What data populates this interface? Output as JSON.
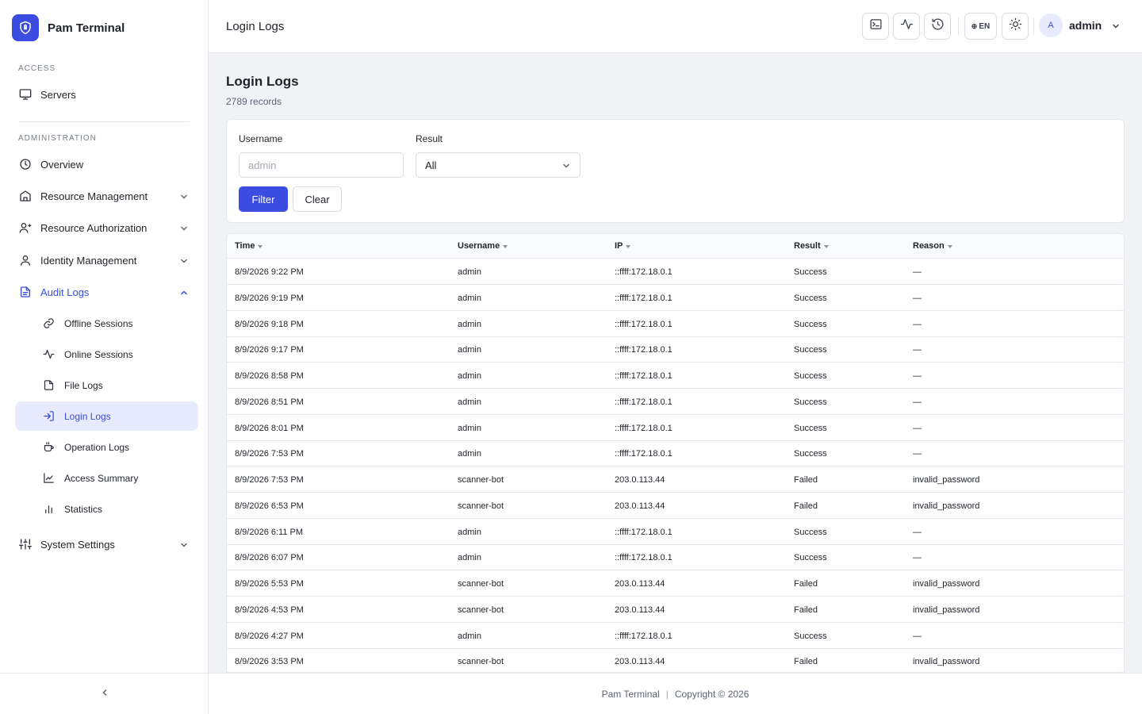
{
  "app": {
    "name": "Pam Terminal"
  },
  "sidebar": {
    "sections": [
      {
        "label": "ACCESS"
      },
      {
        "label": "ADMINISTRATION"
      }
    ],
    "access_items": [
      {
        "label": "Servers",
        "icon": "monitor-icon"
      }
    ],
    "admin_items": [
      {
        "label": "Overview",
        "icon": "clock-icon"
      },
      {
        "label": "Resource Management",
        "icon": "building-icon"
      },
      {
        "label": "Resource Authorization",
        "icon": "user-key-icon"
      },
      {
        "label": "Identity Management",
        "icon": "user-icon"
      },
      {
        "label": "Audit Logs",
        "icon": "file-text-icon",
        "expanded": true
      },
      {
        "label": "System Settings",
        "icon": "sliders-icon"
      }
    ],
    "audit_subitems": [
      {
        "label": "Offline Sessions",
        "icon": "link-icon"
      },
      {
        "label": "Online Sessions",
        "icon": "activity-icon"
      },
      {
        "label": "File Logs",
        "icon": "file-icon"
      },
      {
        "label": "Login Logs",
        "icon": "login-icon",
        "active": true
      },
      {
        "label": "Operation Logs",
        "icon": "coffee-icon"
      },
      {
        "label": "Access Summary",
        "icon": "line-chart-icon"
      },
      {
        "label": "Statistics",
        "icon": "bar-chart-icon"
      }
    ]
  },
  "header": {
    "title": "Login Logs",
    "lang": "EN",
    "user": {
      "initial": "A",
      "name": "admin"
    }
  },
  "page": {
    "title": "Login Logs",
    "count_text": "2789 records"
  },
  "filters": {
    "username_label": "Username",
    "username_placeholder": "admin",
    "result_label": "Result",
    "result_value": "All",
    "filter_button": "Filter",
    "clear_button": "Clear"
  },
  "table": {
    "columns": [
      "Time",
      "Username",
      "IP",
      "Result",
      "Reason"
    ],
    "rows": [
      [
        "8/9/2026 9:22 PM",
        "admin",
        "::ffff:172.18.0.1",
        "Success",
        "—"
      ],
      [
        "8/9/2026 9:19 PM",
        "admin",
        "::ffff:172.18.0.1",
        "Success",
        "—"
      ],
      [
        "8/9/2026 9:18 PM",
        "admin",
        "::ffff:172.18.0.1",
        "Success",
        "—"
      ],
      [
        "8/9/2026 9:17 PM",
        "admin",
        "::ffff:172.18.0.1",
        "Success",
        "—"
      ],
      [
        "8/9/2026 8:58 PM",
        "admin",
        "::ffff:172.18.0.1",
        "Success",
        "—"
      ],
      [
        "8/9/2026 8:51 PM",
        "admin",
        "::ffff:172.18.0.1",
        "Success",
        "—"
      ],
      [
        "8/9/2026 8:01 PM",
        "admin",
        "::ffff:172.18.0.1",
        "Success",
        "—"
      ],
      [
        "8/9/2026 7:53 PM",
        "admin",
        "::ffff:172.18.0.1",
        "Success",
        "—"
      ],
      [
        "8/9/2026 7:53 PM",
        "scanner-bot",
        "203.0.113.44",
        "Failed",
        "invalid_password"
      ],
      [
        "8/9/2026 6:53 PM",
        "scanner-bot",
        "203.0.113.44",
        "Failed",
        "invalid_password"
      ],
      [
        "8/9/2026 6:11 PM",
        "admin",
        "::ffff:172.18.0.1",
        "Success",
        "—"
      ],
      [
        "8/9/2026 6:07 PM",
        "admin",
        "::ffff:172.18.0.1",
        "Success",
        "—"
      ],
      [
        "8/9/2026 5:53 PM",
        "scanner-bot",
        "203.0.113.44",
        "Failed",
        "invalid_password"
      ],
      [
        "8/9/2026 4:53 PM",
        "scanner-bot",
        "203.0.113.44",
        "Failed",
        "invalid_password"
      ],
      [
        "8/9/2026 4:27 PM",
        "admin",
        "::ffff:172.18.0.1",
        "Success",
        "—"
      ],
      [
        "8/9/2026 3:53 PM",
        "scanner-bot",
        "203.0.113.44",
        "Failed",
        "invalid_password"
      ]
    ]
  },
  "footer": {
    "brand": "Pam Terminal",
    "copyright": "Copyright © 2026"
  },
  "colors": {
    "accent": "#3b4de0",
    "active_bg": "#e8ebfd"
  }
}
